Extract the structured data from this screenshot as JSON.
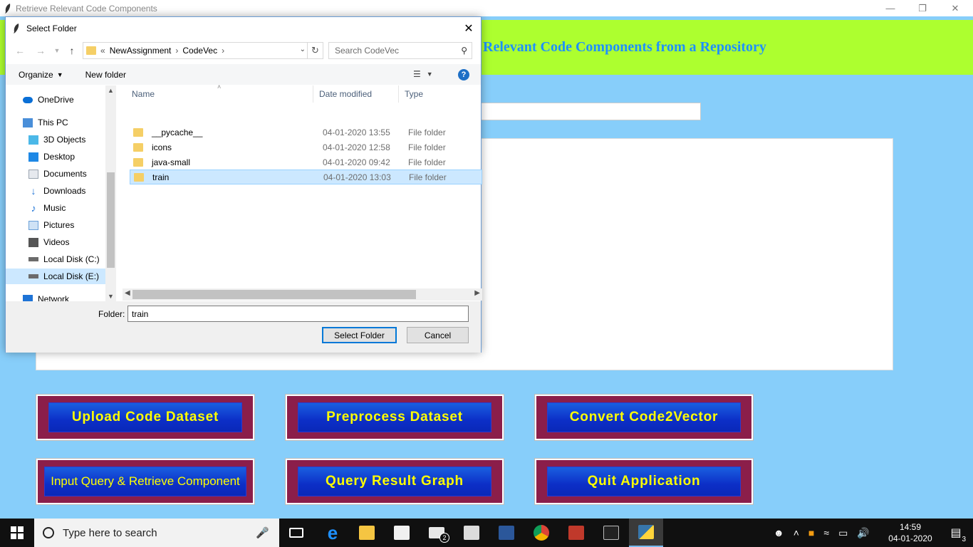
{
  "app": {
    "window_title": "Retrieve Relevant Code Components",
    "header_title": "Relevant Code Components from a Repository",
    "buttons": [
      "Upload Code Dataset",
      "Preprocess Dataset",
      "Convert Code2Vector",
      "Input Query & Retrieve Component",
      "Query Result Graph",
      "Quit Application"
    ]
  },
  "dialog": {
    "title": "Select Folder",
    "breadcrumb": {
      "prefix": "«",
      "parts": [
        "NewAssignment",
        "CodeVec"
      ]
    },
    "search_placeholder": "Search CodeVec",
    "commands": {
      "organize": "Organize",
      "new_folder": "New folder",
      "help": "?"
    },
    "nav_items": [
      {
        "label": "OneDrive",
        "icon": "onedrive-icon",
        "color": "#0a6fd6"
      },
      {
        "label": "This PC",
        "icon": "pc-icon",
        "color": "#4a8fd9"
      },
      {
        "label": "3D Objects",
        "icon": "cube-icon",
        "color": "#4bb8e8"
      },
      {
        "label": "Desktop",
        "icon": "desktop-icon",
        "color": "#1e88e5"
      },
      {
        "label": "Documents",
        "icon": "document-icon",
        "color": "#9aa4b0"
      },
      {
        "label": "Downloads",
        "icon": "download-icon",
        "color": "#1e73d6"
      },
      {
        "label": "Music",
        "icon": "music-icon",
        "color": "#1e73d6"
      },
      {
        "label": "Pictures",
        "icon": "picture-icon",
        "color": "#6aa0d8"
      },
      {
        "label": "Videos",
        "icon": "video-icon",
        "color": "#555555"
      },
      {
        "label": "Local Disk (C:)",
        "icon": "disk-icon",
        "color": "#6b6b6b"
      },
      {
        "label": "Local Disk (E:)",
        "icon": "disk-icon",
        "color": "#6b6b6b"
      },
      {
        "label": "Network",
        "icon": "network-icon",
        "color": "#1e73d6"
      }
    ],
    "selected_nav": "Local Disk (E:)",
    "columns": {
      "name": "Name",
      "date": "Date modified",
      "type": "Type"
    },
    "files": [
      {
        "name": "__pycache__",
        "date": "04-01-2020 13:55",
        "type": "File folder"
      },
      {
        "name": "icons",
        "date": "04-01-2020 12:58",
        "type": "File folder"
      },
      {
        "name": "java-small",
        "date": "04-01-2020 09:42",
        "type": "File folder"
      },
      {
        "name": "train",
        "date": "04-01-2020 13:03",
        "type": "File folder"
      }
    ],
    "selected_file": "train",
    "folder_label": "Folder:",
    "folder_value": "train",
    "select_button": "Select Folder",
    "cancel_button": "Cancel"
  },
  "taskbar": {
    "search_placeholder": "Type here to search",
    "mail_badge": "2",
    "time": "14:59",
    "date": "04-01-2020",
    "notification_count": "3"
  },
  "colors": {
    "app_background": "#87cefa",
    "header_band": "#adff2f",
    "header_text": "#1e90ff",
    "button_frame": "#8b1e4a",
    "button_face": "#0c2fc7",
    "button_text": "#ffff00"
  }
}
